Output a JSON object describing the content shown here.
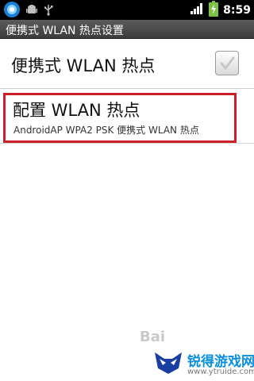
{
  "status_bar": {
    "time": "8:59",
    "icons": [
      "app-notification-icon",
      "android-debug-icon",
      "usb-icon",
      "signal-icon",
      "battery-charging-icon"
    ]
  },
  "title_bar": {
    "title": "便携式 WLAN 热点设置"
  },
  "settings": {
    "portable_hotspot": {
      "label": "便携式 WLAN 热点",
      "checked": true
    },
    "configure_hotspot": {
      "title": "配置 WLAN 热点",
      "summary": "AndroidAP WPA2 PSK 便携式 WLAN 热点"
    }
  },
  "watermarks": {
    "baidu": "Bai",
    "site_name": "锐得游戏网",
    "site_url": "www.ytruide.com"
  },
  "colors": {
    "highlight_border": "#cc1f27",
    "title_bar": "#4a4a4a",
    "site_name": "#0a8fe0"
  }
}
